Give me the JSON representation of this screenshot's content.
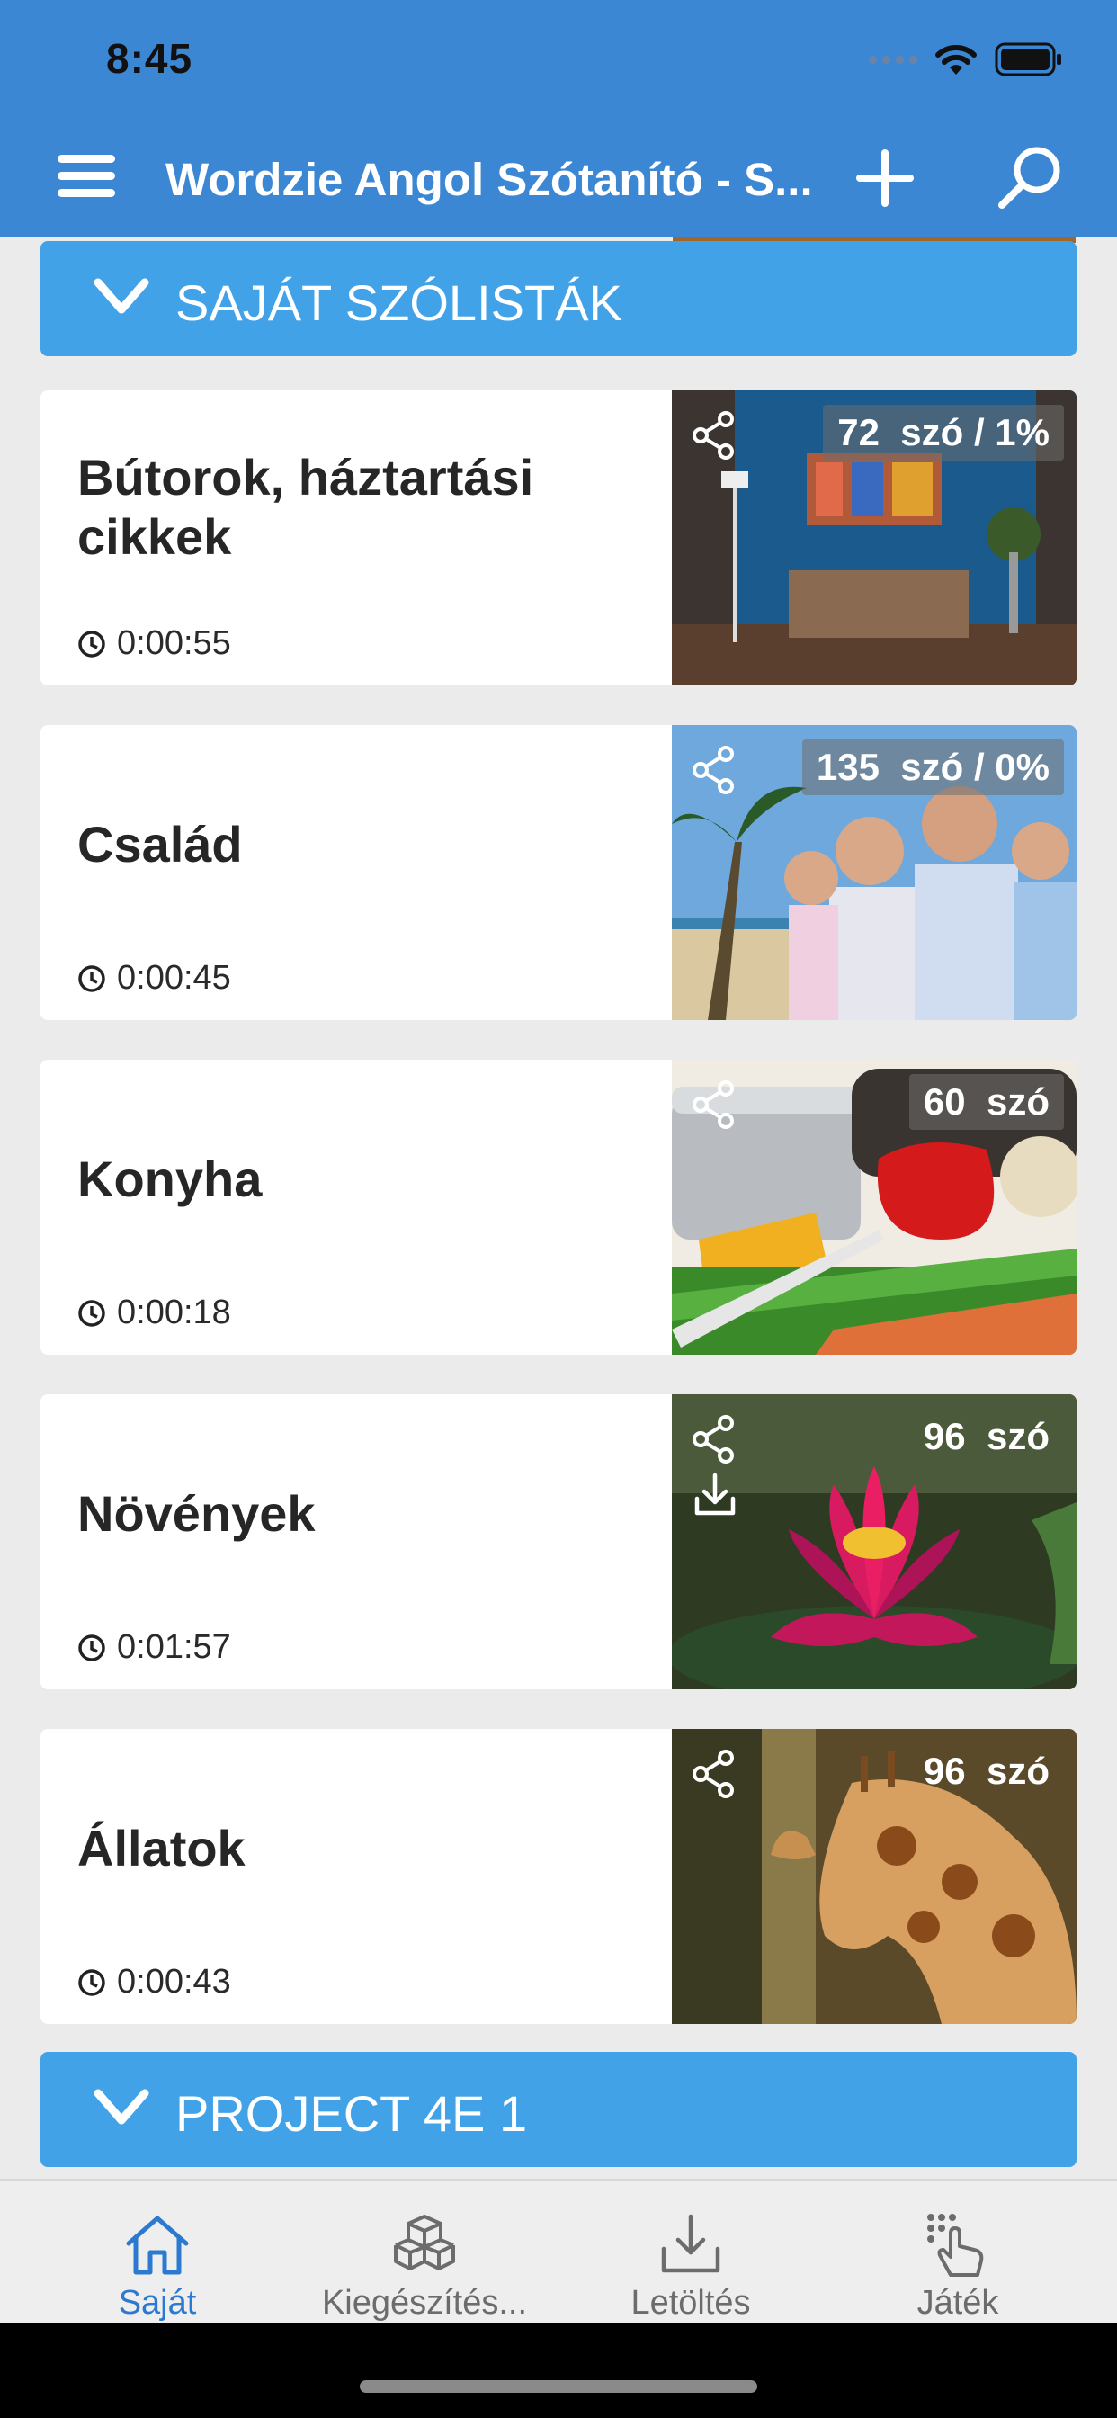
{
  "status_bar": {
    "time": "8:45"
  },
  "header": {
    "title": "Wordzie Angol Szótanító - S..."
  },
  "sections": [
    {
      "label": "SAJÁT SZÓLISTÁK"
    },
    {
      "label": "PROJECT 4E 1"
    }
  ],
  "cards": [
    {
      "title": "Bútorok, háztartási cikkek",
      "time": "0:00:55",
      "count": "72  szó / 1%",
      "downloadable": false
    },
    {
      "title": "Család",
      "time": "0:00:45",
      "count": "135  szó / 0%",
      "downloadable": false
    },
    {
      "title": "Konyha",
      "time": "0:00:18",
      "count": "60  szó",
      "downloadable": false
    },
    {
      "title": "Növények",
      "time": "0:01:57",
      "count": "96  szó",
      "downloadable": true
    },
    {
      "title": "Állatok",
      "time": "0:00:43",
      "count": "96  szó",
      "downloadable": false
    }
  ],
  "tabs": [
    {
      "label": "Saját",
      "icon": "home-icon",
      "active": true
    },
    {
      "label": "Kiegészítés...",
      "icon": "cubes-icon",
      "active": false
    },
    {
      "label": "Letöltés",
      "icon": "download-icon",
      "active": false
    },
    {
      "label": "Játék",
      "icon": "touch-icon",
      "active": false
    }
  ],
  "colors": {
    "header": "#3b87d4",
    "section": "#42a2e8",
    "active_tab": "#2b79d0",
    "background": "#ebebeb"
  }
}
